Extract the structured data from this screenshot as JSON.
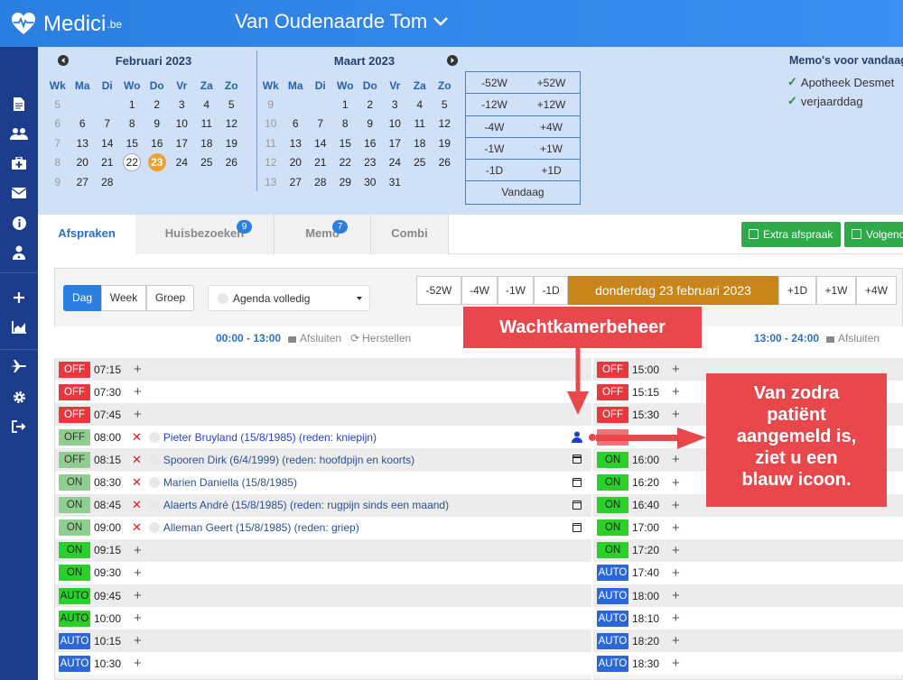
{
  "app": {
    "name": "Medici",
    "suffix": ".be",
    "patient": "Van Oudenaarde Tom"
  },
  "sidebar": {
    "icons": [
      "document-icon",
      "users-icon",
      "medkit-icon",
      "mail-icon",
      "info-icon",
      "doctor-icon",
      "plus-icon",
      "chart-icon",
      "plane-icon",
      "gear-icon",
      "logout-icon"
    ]
  },
  "calendar": {
    "feb": {
      "title": "Februari 2023",
      "headers": [
        "Wk",
        "Ma",
        "Di",
        "Wo",
        "Do",
        "Vr",
        "Za",
        "Zo"
      ],
      "rows": [
        [
          "5",
          "",
          "",
          "1",
          "2",
          "3",
          "4",
          "5"
        ],
        [
          "6",
          "6",
          "7",
          "8",
          "9",
          "10",
          "11",
          "12"
        ],
        [
          "7",
          "13",
          "14",
          "15",
          "16",
          "17",
          "18",
          "19"
        ],
        [
          "8",
          "20",
          "21",
          "22",
          "23",
          "24",
          "25",
          "26"
        ],
        [
          "9",
          "27",
          "28",
          "",
          "",
          "",
          "",
          ""
        ]
      ]
    },
    "mar": {
      "title": "Maart 2023",
      "headers": [
        "Wk",
        "Ma",
        "Di",
        "Wo",
        "Do",
        "Vr",
        "Za",
        "Zo"
      ],
      "rows": [
        [
          "9",
          "",
          "",
          "1",
          "2",
          "3",
          "4",
          "5"
        ],
        [
          "10",
          "6",
          "7",
          "8",
          "9",
          "10",
          "11",
          "12"
        ],
        [
          "11",
          "13",
          "14",
          "15",
          "16",
          "17",
          "18",
          "19"
        ],
        [
          "12",
          "20",
          "21",
          "22",
          "23",
          "24",
          "25",
          "26"
        ],
        [
          "13",
          "27",
          "28",
          "29",
          "30",
          "31",
          "",
          ""
        ]
      ]
    },
    "selected_day": "22",
    "today": "23"
  },
  "jump": {
    "rows": [
      [
        "-52W",
        "+52W"
      ],
      [
        "-12W",
        "+12W"
      ],
      [
        "-4W",
        "+4W"
      ],
      [
        "-1W",
        "+1W"
      ],
      [
        "-1D",
        "+1D"
      ]
    ],
    "today_label": "Vandaag"
  },
  "memos": {
    "title": "Memo's voor vandaag",
    "items": [
      "Apotheek Desmet",
      "verjaarddag"
    ]
  },
  "tabs": [
    {
      "label": "Afspraken",
      "badge": ""
    },
    {
      "label": "Huisbezoeken",
      "badge": "9"
    },
    {
      "label": "Memo",
      "badge": "7"
    },
    {
      "label": "Combi",
      "badge": ""
    }
  ],
  "actions": {
    "extra": "Extra afspraak",
    "next": "Volgende"
  },
  "view": {
    "dag": "Dag",
    "week": "Week",
    "groep": "Groep",
    "agenda": "Agenda volledig"
  },
  "daynav": {
    "left": [
      "-52W",
      "-4W",
      "-1W",
      "-1D"
    ],
    "date": "donderdag 23 februari 2023",
    "right": [
      "+1D",
      "+1W",
      "+4W"
    ]
  },
  "left_half": {
    "range": "00:00 - 13:00",
    "close": "Afsluiten",
    "restore": "Herstellen"
  },
  "right_half": {
    "range": "13:00 - 24:00",
    "close": "Afsluiten"
  },
  "left_slots": [
    {
      "status": "OFF",
      "time": "07:15",
      "patient": ""
    },
    {
      "status": "OFF",
      "time": "07:30",
      "patient": ""
    },
    {
      "status": "OFF",
      "time": "07:45",
      "patient": ""
    },
    {
      "status": "OFF",
      "time": "08:00",
      "patient": "Pieter Bruyland (15/8/1985) (reden: kniepijn)",
      "icon": "user"
    },
    {
      "status": "OFF",
      "time": "08:15",
      "patient": "Spooren Dirk (6/4/1999) (reden: hoofdpijn en koorts)",
      "icon": "cal"
    },
    {
      "status": "ON",
      "time": "08:30",
      "patient": "Marien Daniella (15/8/1985)",
      "icon": "cal"
    },
    {
      "status": "ON",
      "time": "08:45",
      "patient": "Alaerts André (15/8/1985) (reden: rugpijn sinds een maand)",
      "icon": "cal"
    },
    {
      "status": "ON",
      "time": "09:00",
      "patient": "Alleman Geert (15/8/1985) (reden: griep)",
      "icon": "cal"
    },
    {
      "status": "ON",
      "time": "09:15",
      "patient": ""
    },
    {
      "status": "ON",
      "time": "09:30",
      "patient": ""
    },
    {
      "status": "AUTO",
      "time": "09:45",
      "patient": ""
    },
    {
      "status": "AUTO",
      "time": "10:00",
      "patient": ""
    },
    {
      "status": "AUTO",
      "time": "10:15",
      "patient": ""
    },
    {
      "status": "AUTO",
      "time": "10:30",
      "patient": ""
    }
  ],
  "right_slots": [
    {
      "status": "OFF",
      "time": "15:00"
    },
    {
      "status": "OFF",
      "time": "15:15"
    },
    {
      "status": "OFF",
      "time": "15:30"
    },
    {
      "status": "",
      "time": ""
    },
    {
      "status": "ON",
      "time": "16:00"
    },
    {
      "status": "ON",
      "time": "16:20"
    },
    {
      "status": "ON",
      "time": "16:40"
    },
    {
      "status": "ON",
      "time": "17:00"
    },
    {
      "status": "ON",
      "time": "17:20"
    },
    {
      "status": "AUTO",
      "time": "17:40"
    },
    {
      "status": "AUTO",
      "time": "18:00"
    },
    {
      "status": "AUTO",
      "time": "18:10"
    },
    {
      "status": "AUTO",
      "time": "18:20"
    },
    {
      "status": "AUTO",
      "time": "18:30"
    }
  ],
  "annotations": {
    "wachtkamer": "Wachtkamerbeheer",
    "callout": [
      "Van zodra",
      "patiënt",
      "aangemeld is,",
      "ziet u een",
      "blauw icoon."
    ]
  },
  "colors": {
    "topbar": "#2a7fe0",
    "sidebar": "#1c3d8c",
    "calendar_bg": "#cfe0f7",
    "date_bar": "#c8861a",
    "annotation": "#e8484c"
  }
}
